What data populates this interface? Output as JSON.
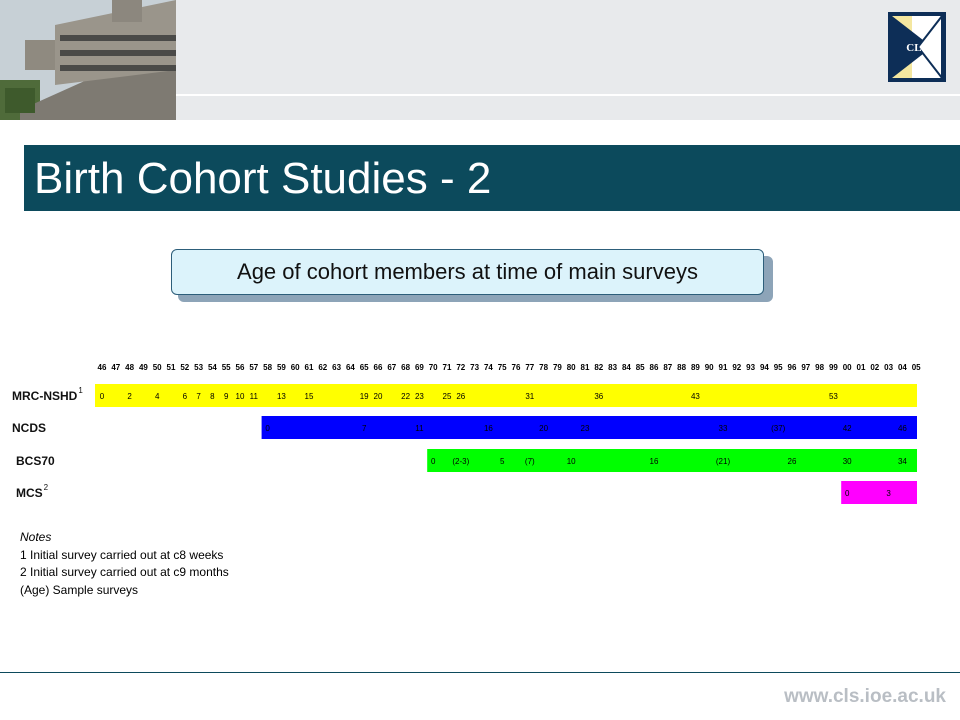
{
  "header": {
    "logo_text": "CLS"
  },
  "slide": {
    "title": "Birth Cohort Studies - 2",
    "subtitle": "Age of cohort members at time of main surveys"
  },
  "chart_data": {
    "type": "bar",
    "orientation": "horizontal-timeline",
    "years": [
      "46",
      "47",
      "48",
      "49",
      "50",
      "51",
      "52",
      "53",
      "54",
      "55",
      "56",
      "57",
      "58",
      "59",
      "60",
      "61",
      "62",
      "63",
      "64",
      "65",
      "66",
      "67",
      "68",
      "69",
      "70",
      "71",
      "72",
      "73",
      "74",
      "75",
      "76",
      "77",
      "78",
      "79",
      "80",
      "81",
      "82",
      "83",
      "84",
      "85",
      "86",
      "87",
      "88",
      "89",
      "90",
      "91",
      "92",
      "93",
      "94",
      "95",
      "96",
      "97",
      "98",
      "99",
      "00",
      "01",
      "02",
      "03",
      "04",
      "05"
    ],
    "series": [
      {
        "name": "MRC-NSHD",
        "superscript": "1",
        "color": "#ffff00",
        "labels": [
          [
            "46",
            "0"
          ],
          [
            "48",
            "2"
          ],
          [
            "50",
            "4"
          ],
          [
            "52",
            "6"
          ],
          [
            "53",
            "7"
          ],
          [
            "54",
            "8"
          ],
          [
            "55",
            "9"
          ],
          [
            "56",
            "10"
          ],
          [
            "57",
            "11"
          ],
          [
            "59",
            "13"
          ],
          [
            "61",
            "15"
          ],
          [
            "65",
            "19"
          ],
          [
            "66",
            "20"
          ],
          [
            "68",
            "22"
          ],
          [
            "69",
            "23"
          ],
          [
            "71",
            "25"
          ],
          [
            "72",
            "26"
          ],
          [
            "77",
            "31"
          ],
          [
            "82",
            "36"
          ],
          [
            "89",
            "43"
          ],
          [
            "99",
            "53"
          ]
        ]
      },
      {
        "name": "NCDS",
        "superscript": "",
        "color": "#0000ff",
        "labels": [
          [
            "58",
            "0"
          ],
          [
            "65",
            "7"
          ],
          [
            "69",
            "11"
          ],
          [
            "74",
            "16"
          ],
          [
            "78",
            "20"
          ],
          [
            "81",
            "23"
          ],
          [
            "91",
            "33"
          ],
          [
            "95",
            "(37)"
          ],
          [
            "00",
            "42"
          ],
          [
            "04",
            "46"
          ]
        ]
      },
      {
        "name": "BCS70",
        "superscript": "",
        "color": "#00ff00",
        "labels": [
          [
            "70",
            "0"
          ],
          [
            "72",
            "(2-3)"
          ],
          [
            "75",
            "5"
          ],
          [
            "77",
            "(7)"
          ],
          [
            "80",
            "10"
          ],
          [
            "86",
            "16"
          ],
          [
            "91",
            "(21)"
          ],
          [
            "96",
            "26"
          ],
          [
            "00",
            "30"
          ],
          [
            "04",
            "34"
          ]
        ]
      },
      {
        "name": "MCS",
        "superscript": "2",
        "color": "#ff00ff",
        "labels": [
          [
            "00",
            "0"
          ],
          [
            "03",
            "3"
          ]
        ]
      }
    ]
  },
  "notes": {
    "title": "Notes",
    "lines": [
      "1 Initial survey carried out at c8 weeks",
      "2 Initial survey carried out at c9 months",
      "(Age) Sample surveys"
    ]
  },
  "footer": {
    "url": "www.cls.ioe.ac.uk"
  }
}
